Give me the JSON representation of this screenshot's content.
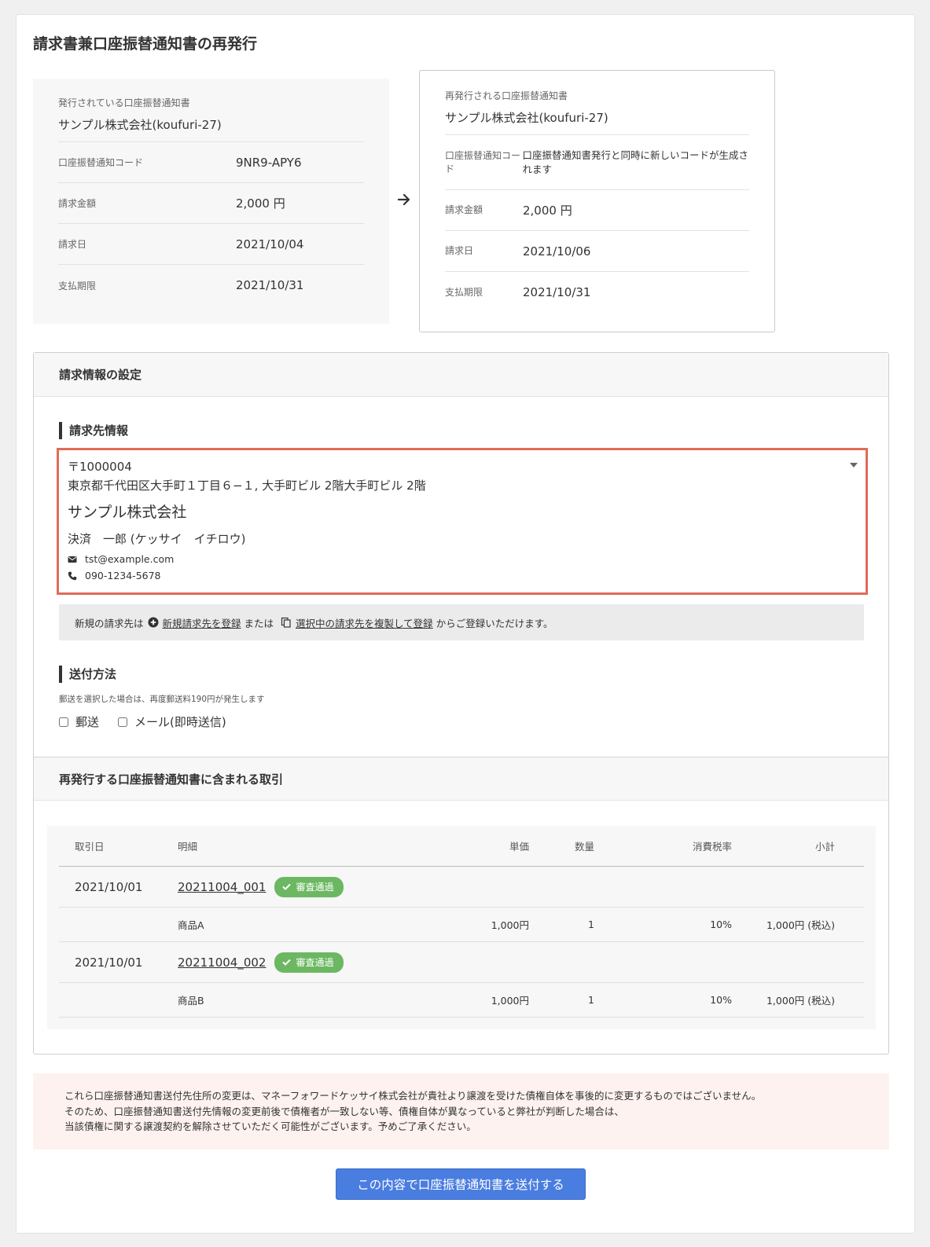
{
  "page": {
    "title": "請求書兼口座振替通知書の再発行"
  },
  "old_notice": {
    "caption": "発行されている口座振替通知書",
    "company": "サンプル株式会社(koufuri-27)",
    "rows": [
      {
        "key": "口座振替通知コード",
        "value": "9NR9-APY6"
      },
      {
        "key": "請求金額",
        "value": "2,000 円"
      },
      {
        "key": "請求日",
        "value": "2021/10/04"
      },
      {
        "key": "支払期限",
        "value": "2021/10/31"
      }
    ]
  },
  "new_notice": {
    "caption": "再発行される口座振替通知書",
    "company": "サンプル株式会社(koufuri-27)",
    "rows": [
      {
        "key": "口座振替通知コード",
        "value": "口座振替通知書発行と同時に新しいコードが生成されます"
      },
      {
        "key": "請求金額",
        "value": "2,000 円"
      },
      {
        "key": "請求日",
        "value": "2021/10/06"
      },
      {
        "key": "支払期限",
        "value": "2021/10/31"
      }
    ]
  },
  "settings": {
    "header": "請求情報の設定",
    "billing_section_title": "請求先情報",
    "billing": {
      "zip": "〒1000004",
      "address": "東京都千代田区大手町１丁目６−１, 大手町ビル 2階大手町ビル 2階",
      "company": "サンプル株式会社",
      "person": "決済　一郎 (ケッサイ　イチロウ)",
      "email": "tst@example.com",
      "phone": "090-1234-5678"
    },
    "info_bar": {
      "prefix": "新規の請求先は",
      "link_new": "新規請求先を登録",
      "or": "または",
      "link_copy": "選択中の請求先を複製して登録",
      "suffix": "からご登録いただけます。"
    },
    "delivery_section_title": "送付方法",
    "delivery_note": "郵送を選択した場合は、再度郵送料190円が発生します",
    "delivery_options": [
      {
        "label": "郵送",
        "checked": false
      },
      {
        "label": "メール(即時送信)",
        "checked": false
      }
    ]
  },
  "transactions": {
    "header": "再発行する口座振替通知書に含まれる取引",
    "columns": [
      "取引日",
      "明細",
      "単価",
      "数量",
      "消費税率",
      "小計"
    ],
    "items": [
      {
        "date": "2021/10/01",
        "id": "20211004_001",
        "badge": "審査通過",
        "line": {
          "name": "商品A",
          "price": "1,000円",
          "qty": "1",
          "tax": "10%",
          "subtotal": "1,000円 (税込)"
        }
      },
      {
        "date": "2021/10/01",
        "id": "20211004_002",
        "badge": "審査通過",
        "line": {
          "name": "商品B",
          "price": "1,000円",
          "qty": "1",
          "tax": "10%",
          "subtotal": "1,000円 (税込)"
        }
      }
    ]
  },
  "warning": {
    "line1": "これら口座振替通知書送付先住所の変更は、マネーフォワードケッサイ株式会社が貴社より譲渡を受けた債権自体を事後的に変更するものではございません。",
    "line2": "そのため、口座振替通知書送付先情報の変更前後で債権者が一致しない等、債権自体が異なっていると弊社が判断した場合は、",
    "line3": "当該債権に関する譲渡契約を解除させていただく可能性がございます。予めご了承ください。"
  },
  "submit_label": "この内容で口座振替通知書を送付する",
  "colors": {
    "accent": "#4a7de0",
    "highlight_border": "#e06b5a",
    "badge_green": "#6cb862",
    "warning_bg": "#fdf2ef"
  }
}
